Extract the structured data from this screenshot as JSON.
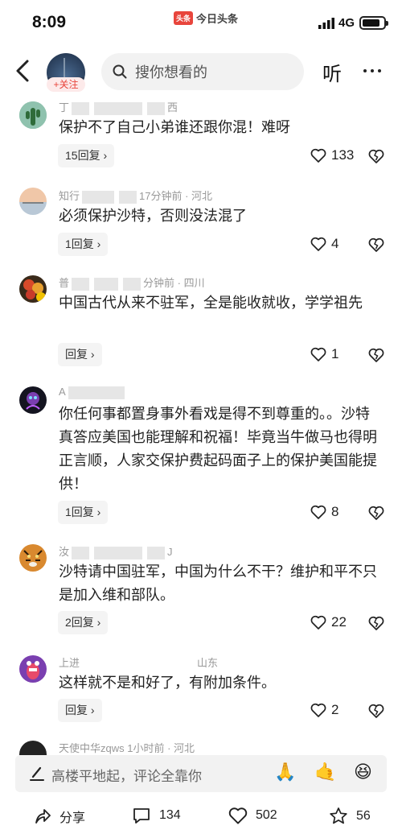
{
  "status_bar": {
    "time": "8:09",
    "app_name": "今日头条",
    "app_logo": "头条",
    "network": "4G"
  },
  "header": {
    "follow_label": "+关注",
    "search_placeholder": "搜你想看的",
    "listen_label": "听"
  },
  "comments": [
    {
      "name_fragment": "丁",
      "meta_tail": "西",
      "text": "保护不了自己小弟谁还跟你混！难呀",
      "reply": "15回复 ›",
      "likes": "133"
    },
    {
      "name_fragment": "知行",
      "meta_tail": "17分钟前 · 河北",
      "text": "必须保护沙特，否则没法混了",
      "reply": "1回复 ›",
      "likes": "4"
    },
    {
      "name_fragment": "普",
      "meta_tail": "分钟前 · 四川",
      "text": "中国古代从来不驻军，全是能收就收，学学祖先",
      "reply": "回复 ›",
      "likes": "1"
    },
    {
      "name_fragment": "A",
      "meta_tail": "",
      "text": "你任何事都置身事外看戏是得不到尊重的。。沙特真答应美国也能理解和祝福！毕竟当牛做马也得明正言顺，人家交保护费起码面子上的保护美国能提供！",
      "reply": "1回复 ›",
      "likes": "8"
    },
    {
      "name_fragment": "汝",
      "meta_tail": "J",
      "text": "沙特请中国驻军，中国为什么不干？维护和平不只是加入维和部队。",
      "reply": "2回复 ›",
      "likes": "22"
    },
    {
      "name_fragment": "上进",
      "meta_tail": "山东",
      "text": "这样就不是和好了，有附加条件。",
      "reply": "回复 ›",
      "likes": "2"
    },
    {
      "name_fragment": "天使中华zqws",
      "meta_tail": "1小时前 · 河北",
      "text": "",
      "reply": "",
      "likes": ""
    }
  ],
  "comment_input": {
    "placeholder": "高楼平地起，评论全靠你",
    "emojis": [
      "🙏",
      "🤙",
      "😆"
    ]
  },
  "action_bar": {
    "share_label": "分享",
    "comments_count": "134",
    "likes_count": "502",
    "favorites_count": "56"
  },
  "colors": {
    "accent": "#e8453c",
    "input_bg": "#f2f2f2",
    "meta_text": "#999999"
  }
}
